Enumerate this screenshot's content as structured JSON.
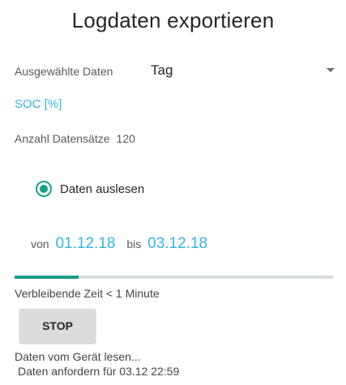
{
  "title": "Logdaten exportieren",
  "selection": {
    "label": "Ausgewählte Daten",
    "value": "Tag"
  },
  "channel": "SOC [%]",
  "records": {
    "label": "Anzahl Datensätze",
    "value": "120"
  },
  "mode": {
    "label": "Daten auslesen",
    "selected": true
  },
  "range": {
    "from_label": "von",
    "from": "01.12.18",
    "to_label": "bis",
    "to": "03.12.18"
  },
  "progress": {
    "fraction": 0.2
  },
  "remaining_time": "Verbleibende Zeit < 1 Minute",
  "stop_label": "STOP",
  "status": {
    "line1": "Daten vom Gerät lesen...",
    "line2": "Daten anfordern für 03.12 22:59"
  },
  "colors": {
    "accent": "#1a9e8f",
    "link": "#33b5e5"
  }
}
